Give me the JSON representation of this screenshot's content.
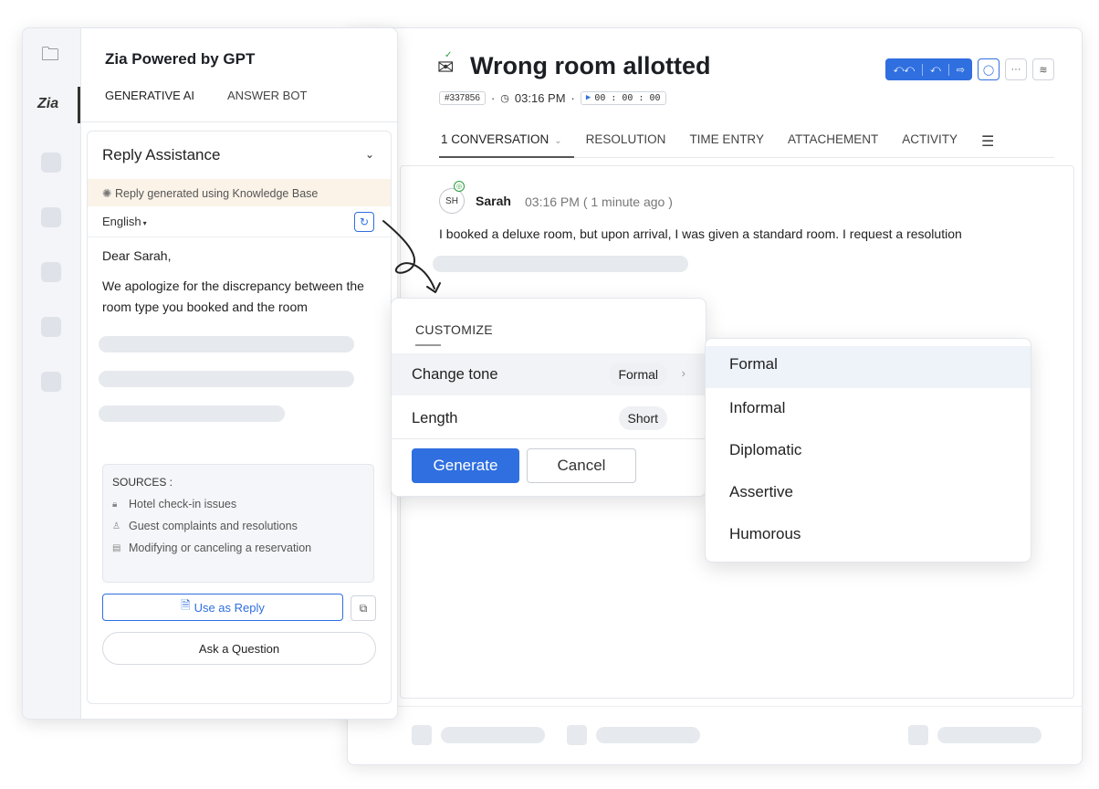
{
  "ticket": {
    "title": "Wrong room allotted",
    "id": "#337856",
    "time": "03:16 PM",
    "timer": "00 : 00 : 00"
  },
  "main_tabs": [
    {
      "label": "1 CONVERSATION"
    },
    {
      "label": "RESOLUTION"
    },
    {
      "label": "TIME ENTRY"
    },
    {
      "label": "ATTACHEMENT"
    },
    {
      "label": "ACTIVITY"
    }
  ],
  "conversation": {
    "initials": "SH",
    "sender": "Sarah",
    "sent_time": "03:16 PM ( 1 minute ago )",
    "message": "I booked a deluxe room, but upon arrival, I was given a standard room. I request a resolution"
  },
  "zia": {
    "title": "Zia Powered by GPT",
    "rail_label": "Zia",
    "tabs": [
      {
        "label": "GENERATIVE AI"
      },
      {
        "label": "ANSWER BOT"
      }
    ],
    "assist_title": "Reply Assistance",
    "kb_banner": "Reply generated using Knowledge Base",
    "language": "English",
    "greeting": "Dear Sarah,",
    "reply_body": "We apologize for the discrepancy between the room type you booked and the room",
    "sources_title": "SOURCES :",
    "sources": [
      {
        "label": "Hotel check-in issues"
      },
      {
        "label": "Guest complaints and resolutions"
      },
      {
        "label": "Modifying or canceling a reservation"
      }
    ],
    "use_reply_label": "Use as Reply",
    "ask_label": "Ask a Question"
  },
  "customize": {
    "title": "CUSTOMIZE",
    "tone_label": "Change tone",
    "tone_value": "Formal",
    "length_label": "Length",
    "length_value": "Short",
    "generate_label": "Generate",
    "cancel_label": "Cancel"
  },
  "tone_options": [
    {
      "label": "Formal"
    },
    {
      "label": "Informal"
    },
    {
      "label": "Diplomatic"
    },
    {
      "label": "Assertive"
    },
    {
      "label": "Humorous"
    }
  ],
  "colors": {
    "accent": "#2f6fe0",
    "kb_banner_bg": "#fbf3e8",
    "selected_option_bg": "#eef2f9"
  },
  "icons": {
    "ticket": "envelope-check-icon",
    "refresh": "refresh-icon",
    "copy": "copy-icon",
    "chevron": "chevron-down-icon"
  }
}
